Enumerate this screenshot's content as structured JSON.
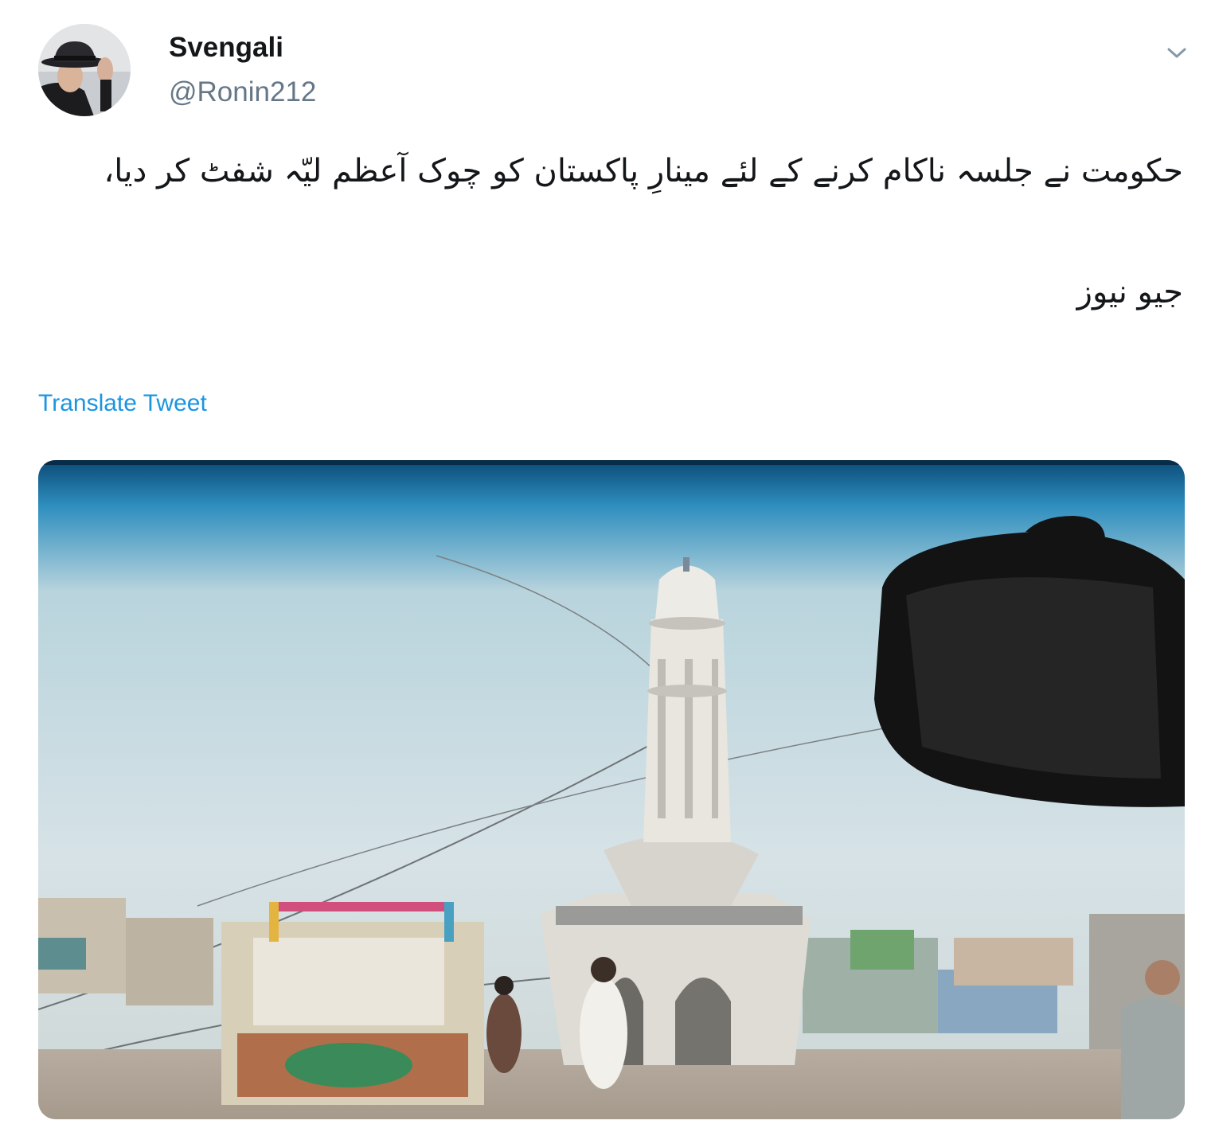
{
  "author": {
    "display_name": "Svengali",
    "handle": "@Ronin212",
    "avatar_icon": "profile-photo"
  },
  "tweet": {
    "text_lines": [
      "حکومت نے جلسہ ناکام کرنے کے لئے مینارِ پاکستان کو چوک آعظم لیّہ شفٹ کر دیا،",
      "جیو نیوز"
    ],
    "translate_label": "Translate Tweet",
    "menu_icon": "chevron-down-icon"
  },
  "media": {
    "type": "photo",
    "subject": "tower-at-chowk-roundabout"
  },
  "colors": {
    "text": "#14171a",
    "secondary": "#657786",
    "link": "#1b95e0"
  }
}
